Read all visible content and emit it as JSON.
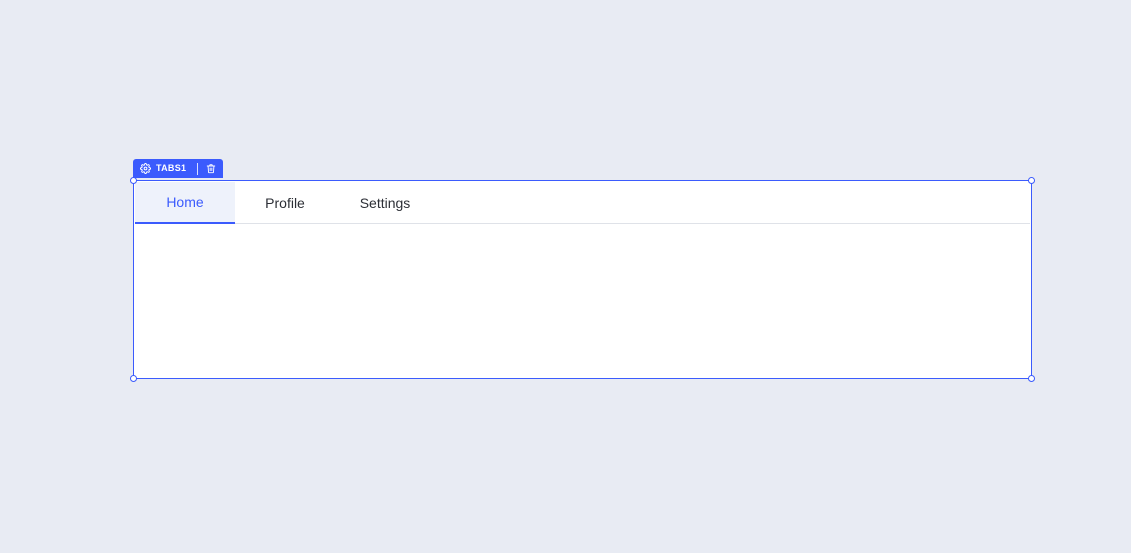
{
  "widget": {
    "name": "TABS1",
    "accent_color": "#3b5bfd",
    "settings_icon": "gear-icon",
    "delete_icon": "trash-icon"
  },
  "tabs": {
    "items": [
      {
        "label": "Home",
        "active": true
      },
      {
        "label": "Profile",
        "active": false
      },
      {
        "label": "Settings",
        "active": false
      }
    ]
  }
}
